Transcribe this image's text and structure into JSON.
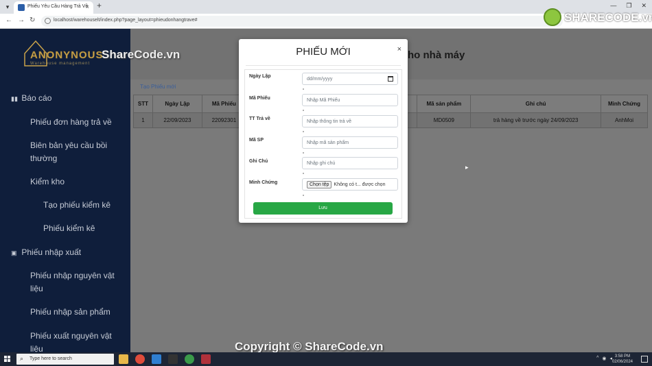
{
  "browser": {
    "tab_title": "Phiếu Yêu Cầu Hàng Trả Về",
    "url": "localhost/warehouselt/index.php?page_layout=phieudonhangtrave#"
  },
  "sidebar": {
    "logo_text": "ANONYNOUS",
    "logo_sub": "Warehouse management",
    "sections": [
      {
        "label": "Báo cáo",
        "icon": "bar-chart-icon"
      },
      {
        "label": "Phiếu nhập xuất",
        "icon": "clipboard-icon"
      }
    ],
    "items": [
      "Phiếu đơn hàng trả về",
      "Biên bản yêu cầu bồi",
      "thường",
      "Kiểm kho",
      "Tạo phiếu kiểm kê",
      "Phiếu kiểm kê",
      "Phiếu nhập nguyên vật",
      "liệu",
      "Phiếu nhập sản phẩm",
      "Phiếu xuất nguyên vật",
      "liệu"
    ]
  },
  "main": {
    "title_fragment": "ho nhà máy",
    "create_link": "Tạo Phiếu mới",
    "table": {
      "headers": [
        "STT",
        "Ngày Lập",
        "Mã Phiếu",
        "Mã sản phẩm",
        "Ghi chú",
        "Minh Chứng"
      ],
      "rows": [
        [
          "1",
          "22/09/2023",
          "22092301",
          "MD0509",
          "trả hàng về trước ngày 24/09/2023",
          "AnhMoi"
        ]
      ]
    }
  },
  "modal": {
    "title": "PHIẾU MỚI",
    "close": "×",
    "fields": [
      {
        "label": "Ngày Lập",
        "placeholder": "dd/mm/yyyy"
      },
      {
        "label": "Mã Phiếu",
        "placeholder": "Nhập Mã Phiếu"
      },
      {
        "label": "TT Trả về",
        "placeholder": "Nhập thông tin trả về"
      },
      {
        "label": "Mã SP",
        "placeholder": "Nhập mã sản phẩm"
      },
      {
        "label": "Ghi Chú",
        "placeholder": "Nhập ghi chú"
      },
      {
        "label": "Minh Chứng",
        "file_button": "Chọn tệp",
        "file_text": "Không có t... được chọn"
      }
    ],
    "submit": "Lưu"
  },
  "watermarks": {
    "top": "ShareCode.vn",
    "bottom": "Copyright © ShareCode.vn",
    "logo": "SHARECODE.vn"
  },
  "taskbar": {
    "search_placeholder": "Type here to search",
    "time": "3:58 PM",
    "date": "02/06/2024"
  },
  "colors": {
    "sidebar_bg": "#0f1e3b",
    "save_button": "#28a745",
    "logo_gold": "#c9a24a"
  }
}
